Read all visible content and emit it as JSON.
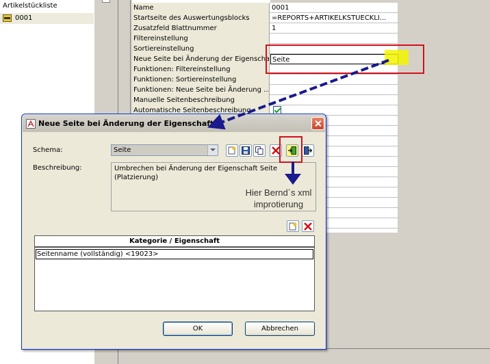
{
  "tree": {
    "root_label": "Artikelstückliste",
    "node_label": "0001"
  },
  "properties": [
    {
      "name": "Name",
      "value": "0001"
    },
    {
      "name": "Startseite des Auswertungsblocks",
      "value": "=REPORTS+ARTIKELKSTUECKLI..."
    },
    {
      "name": "Zusatzfeld Blattnummer",
      "value": "1"
    },
    {
      "name": "Filtereinstellung",
      "value": ""
    },
    {
      "name": "Sortiereinstellung",
      "value": ""
    },
    {
      "name": "Neue Seite bei Änderung der Eigenschaft",
      "value": "Seite"
    },
    {
      "name": "Funktionen: Filtereinstellung",
      "value": ""
    },
    {
      "name": "Funktionen: Sortiereinstellung",
      "value": ""
    },
    {
      "name": "Funktionen: Neue Seite bei Änderung ...",
      "value": ""
    },
    {
      "name": "Manuelle Seitenbeschreibung",
      "value": ""
    },
    {
      "name": "Automatische Seitenbeschreibung",
      "value": "",
      "checked": true
    }
  ],
  "dialog": {
    "title": "Neue Seite bei Änderung der Eigenschaft",
    "schema_label": "Schema:",
    "schema_value": "Seite",
    "description_label": "Beschreibung:",
    "description_text": "Umbrechen bei Änderung der Eigenschaft Seite (Platzierung)",
    "table_header": "Kategorie / Eigenschaft",
    "table_rows": [
      "Seitenname (vollständig) <19023>"
    ],
    "ok_label": "OK",
    "cancel_label": "Abbrechen"
  },
  "annotation": {
    "text": "Hier Bernd´s xml improtierung",
    "line1": "Hier Bernd´s xml",
    "line2": "improtierung",
    "color_rect": "#d0101c",
    "color_highlight": "#f4f400",
    "color_arrow": "#1a1a8c"
  }
}
